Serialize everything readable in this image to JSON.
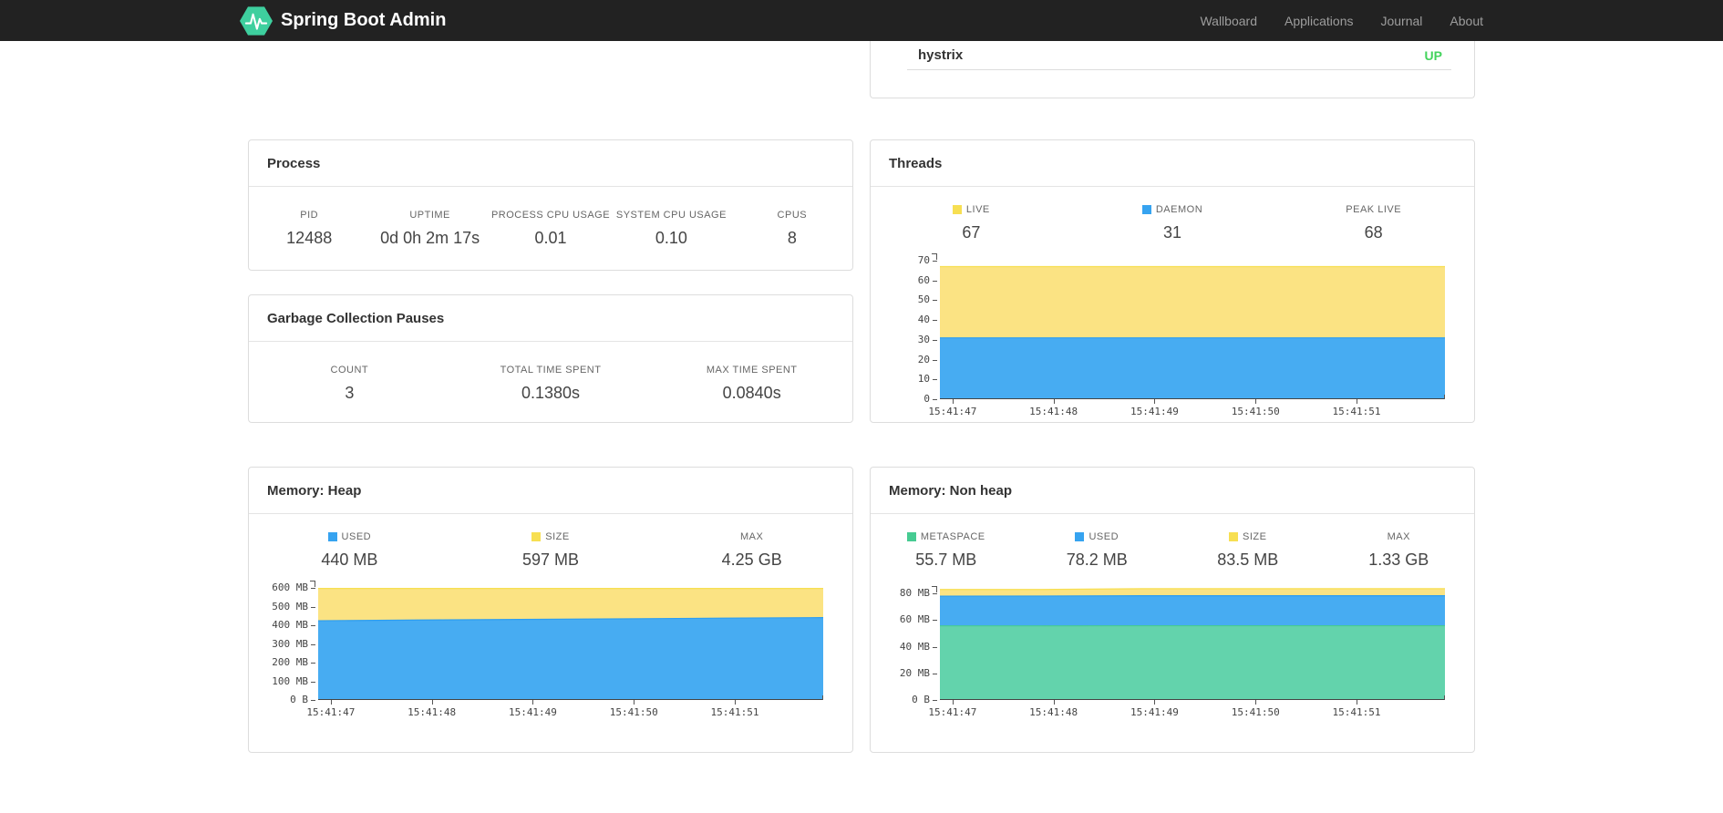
{
  "navbar": {
    "brand": "Spring Boot Admin",
    "links": [
      {
        "label": "Wallboard"
      },
      {
        "label": "Applications"
      },
      {
        "label": "Journal"
      },
      {
        "label": "About"
      }
    ],
    "colors": {
      "bg": "#222222",
      "link": "#9d9d9d",
      "brand_text": "#ffffff",
      "logo_green": "#3ecf9e"
    }
  },
  "status_panel": {
    "row": {
      "name": "hystrix",
      "status": "UP",
      "status_color": "#42d35b"
    }
  },
  "panels": {
    "process": {
      "title": "Process",
      "stats": [
        {
          "label": "PID",
          "value": "12488"
        },
        {
          "label": "UPTIME",
          "value": "0d 0h 2m 17s"
        },
        {
          "label": "PROCESS CPU USAGE",
          "value": "0.01"
        },
        {
          "label": "SYSTEM CPU USAGE",
          "value": "0.10"
        },
        {
          "label": "CPUS",
          "value": "8"
        }
      ]
    },
    "gc": {
      "title": "Garbage Collection Pauses",
      "stats": [
        {
          "label": "COUNT",
          "value": "3"
        },
        {
          "label": "TOTAL TIME SPENT",
          "value": "0.1380s"
        },
        {
          "label": "MAX TIME SPENT",
          "value": "0.0840s"
        }
      ]
    },
    "threads": {
      "title": "Threads",
      "stats": [
        {
          "label": "LIVE",
          "value": "67",
          "swatch": "#f7df52"
        },
        {
          "label": "DAEMON",
          "value": "31",
          "swatch": "#36a3f0"
        },
        {
          "label": "PEAK LIVE",
          "value": "68"
        }
      ]
    },
    "heap": {
      "title": "Memory: Heap",
      "stats": [
        {
          "label": "USED",
          "value": "440 MB",
          "swatch": "#36a3f0"
        },
        {
          "label": "SIZE",
          "value": "597 MB",
          "swatch": "#f7df52"
        },
        {
          "label": "MAX",
          "value": "4.25 GB"
        }
      ]
    },
    "nonheap": {
      "title": "Memory: Non heap",
      "stats": [
        {
          "label": "METASPACE",
          "value": "55.7 MB",
          "swatch": "#46cb92"
        },
        {
          "label": "USED",
          "value": "78.2 MB",
          "swatch": "#36a3f0"
        },
        {
          "label": "SIZE",
          "value": "83.5 MB",
          "swatch": "#f7df52"
        },
        {
          "label": "MAX",
          "value": "1.33 GB"
        }
      ]
    }
  },
  "chart_data": [
    {
      "id": "threads",
      "type": "area",
      "stacked": true,
      "title": "Threads",
      "x_labels": [
        "15:41:47",
        "15:41:48",
        "15:41:49",
        "15:41:50",
        "15:41:51"
      ],
      "x_range": [
        "15:41:47",
        "15:41:52"
      ],
      "ylim": [
        0,
        70
      ],
      "grid": false,
      "legend_position": "top",
      "yticks": [
        {
          "v": 0,
          "label": "0"
        },
        {
          "v": 10,
          "label": "10"
        },
        {
          "v": 20,
          "label": "20"
        },
        {
          "v": 30,
          "label": "30"
        },
        {
          "v": 40,
          "label": "40"
        },
        {
          "v": 50,
          "label": "50"
        },
        {
          "v": 60,
          "label": "60"
        },
        {
          "v": 70,
          "label": "70"
        }
      ],
      "series": [
        {
          "name": "LIVE",
          "fill": "#fbe383",
          "edge": "#f7df52",
          "values": [
            67,
            67,
            67,
            67,
            67,
            67
          ]
        },
        {
          "name": "DAEMON",
          "fill": "#47acf2",
          "edge": "#2d9df0",
          "values": [
            31,
            31,
            31,
            31,
            31,
            31
          ]
        }
      ]
    },
    {
      "id": "heap",
      "type": "area",
      "stacked": true,
      "title": "Memory: Heap",
      "x_labels": [
        "15:41:47",
        "15:41:48",
        "15:41:49",
        "15:41:50",
        "15:41:51"
      ],
      "x_range": [
        "15:41:47",
        "15:41:52"
      ],
      "ylim": [
        0,
        600
      ],
      "units": "MB",
      "grid": false,
      "legend_position": "top",
      "yticks": [
        {
          "v": 0,
          "label": "0 B"
        },
        {
          "v": 100,
          "label": "100 MB"
        },
        {
          "v": 200,
          "label": "200 MB"
        },
        {
          "v": 300,
          "label": "300 MB"
        },
        {
          "v": 400,
          "label": "400 MB"
        },
        {
          "v": 500,
          "label": "500 MB"
        },
        {
          "v": 600,
          "label": "600 MB"
        }
      ],
      "series": [
        {
          "name": "SIZE",
          "fill": "#fbe383",
          "edge": "#f7df52",
          "values": [
            597,
            597,
            597,
            597,
            597,
            597
          ]
        },
        {
          "name": "USED",
          "fill": "#47acf2",
          "edge": "#2d9df0",
          "values": [
            424,
            428,
            431,
            434,
            438,
            441
          ]
        }
      ]
    },
    {
      "id": "nonheap",
      "type": "area",
      "stacked": true,
      "title": "Memory: Non heap",
      "x_labels": [
        "15:41:47",
        "15:41:48",
        "15:41:49",
        "15:41:50",
        "15:41:51"
      ],
      "x_range": [
        "15:41:47",
        "15:41:52"
      ],
      "ylim": [
        0,
        80
      ],
      "units": "MB",
      "grid": false,
      "legend_position": "top",
      "yticks": [
        {
          "v": 0,
          "label": "0 B"
        },
        {
          "v": 20,
          "label": "20 MB"
        },
        {
          "v": 40,
          "label": "40 MB"
        },
        {
          "v": 60,
          "label": "60 MB"
        },
        {
          "v": 80,
          "label": "80 MB"
        }
      ],
      "series": [
        {
          "name": "SIZE",
          "fill": "#fbe383",
          "edge": "#f7df52",
          "values": [
            82.9,
            82.9,
            83.5,
            83.5,
            83.5,
            83.5
          ]
        },
        {
          "name": "USED",
          "fill": "#47acf2",
          "edge": "#2d9df0",
          "values": [
            77.9,
            78.0,
            78.2,
            78.2,
            78.2,
            78.2
          ]
        },
        {
          "name": "METASPACE",
          "fill": "#63d3ac",
          "edge": "#46cb92",
          "values": [
            55.6,
            55.6,
            55.7,
            55.7,
            55.7,
            55.7
          ]
        }
      ]
    }
  ]
}
